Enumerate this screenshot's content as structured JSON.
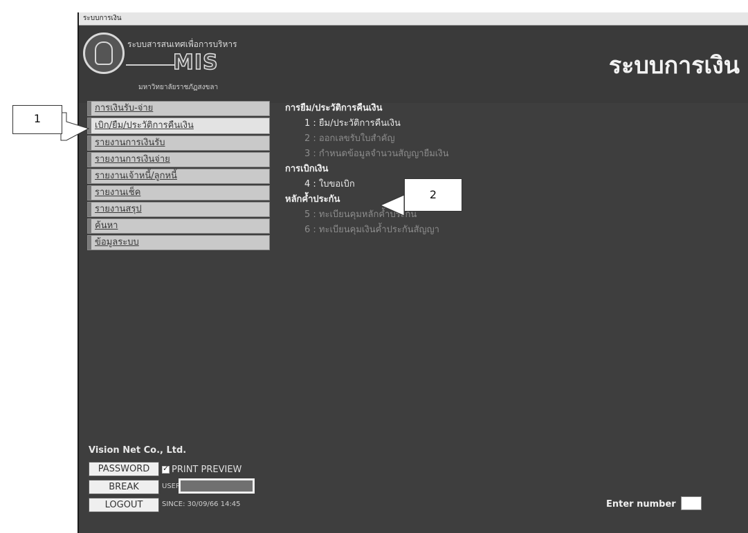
{
  "window": {
    "title": "ระบบการเงิน"
  },
  "header": {
    "logo_top_text": "ระบบสารสนเทศเพื่อการบริหาร",
    "logo_mis": "MIS",
    "logo_bottom_text": "มหาวิทยาลัยราชภัฏสงขลา",
    "app_title": "ระบบการเงิน"
  },
  "menu": {
    "items": [
      {
        "label": "การเงินรับ-จ่าย"
      },
      {
        "label": "เบิก/ยืม/ประวัติการคืนเงิน"
      },
      {
        "label": "รายงานการเงินรับ"
      },
      {
        "label": "รายงานการเงินจ่าย"
      },
      {
        "label": "รายงานเจ้าหนี้/ลูกหนี้"
      },
      {
        "label": "รายงานเช็ค"
      },
      {
        "label": "รายงานสรุป"
      },
      {
        "label": "ค้นหา"
      },
      {
        "label": "ข้อมูลระบบ"
      }
    ],
    "active_index": 1
  },
  "content": {
    "section1": {
      "heading": "การยืม/ประวัติการคืนเงิน",
      "items": [
        {
          "label": "1 : ยืม/ประวัติการคืนเงิน"
        },
        {
          "label": "2 : ออกเลขรับใบสำคัญ"
        },
        {
          "label": "3 : กำหนดข้อมูลจำนวนสัญญายืมเงิน"
        }
      ]
    },
    "section2": {
      "heading": "การเบิกเงิน",
      "items": [
        {
          "label": "4 : ใบขอเบิก"
        }
      ]
    },
    "section3": {
      "heading": "หลักค้ำประกัน",
      "items": [
        {
          "label": "5 : ทะเบียนคุมหลักค้ำประกัน"
        },
        {
          "label": "6 : ทะเบียนคุมเงินค้ำประกันสัญญา"
        }
      ]
    }
  },
  "footer": {
    "company": "Vision Net Co., Ltd.",
    "password_btn": "PASSWORD",
    "break_btn": "BREAK",
    "logout_btn": "LOGOUT",
    "print_preview": "PRINT PREVIEW",
    "user_label": "USER:",
    "since_text": "SINCE: 30/09/66 14:45",
    "enter_number": "Enter number"
  },
  "callouts": {
    "one": "1",
    "two": "2"
  }
}
